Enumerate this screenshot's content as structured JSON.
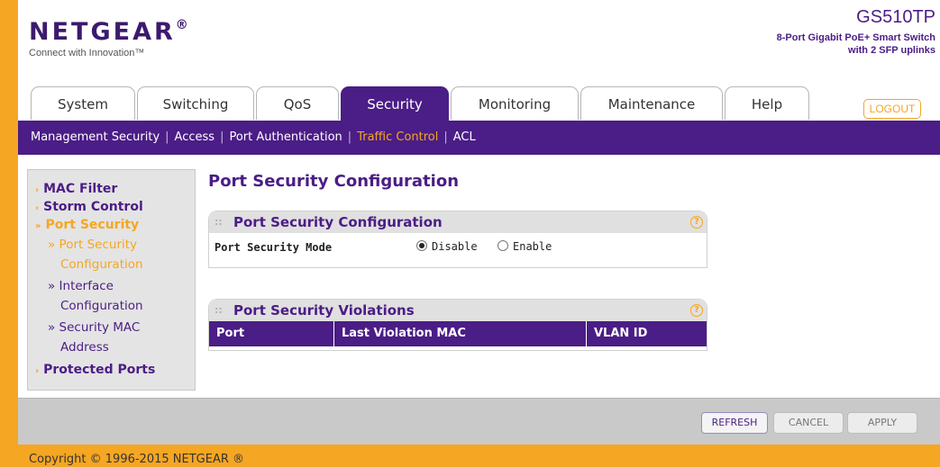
{
  "header": {
    "brand": "NETGEAR",
    "brand_mark": "®",
    "tagline": "Connect with Innovation™",
    "model": "GS510TP",
    "model_desc_line1": "8-Port Gigabit PoE+ Smart Switch",
    "model_desc_line2": "with 2 SFP uplinks",
    "logout_label": "LOGOUT"
  },
  "tabs": [
    {
      "label": "System"
    },
    {
      "label": "Switching"
    },
    {
      "label": "QoS"
    },
    {
      "label": "Security"
    },
    {
      "label": "Monitoring"
    },
    {
      "label": "Maintenance"
    },
    {
      "label": "Help"
    }
  ],
  "subnav": {
    "items": [
      {
        "label": "Management Security"
      },
      {
        "label": "Access"
      },
      {
        "label": "Port Authentication"
      },
      {
        "label": "Traffic Control"
      },
      {
        "label": "ACL"
      }
    ],
    "separator": "|"
  },
  "sidebar": {
    "items": [
      {
        "label": "MAC Filter"
      },
      {
        "label": "Storm Control"
      },
      {
        "label": "Port Security"
      },
      {
        "label": "» Port Security"
      },
      {
        "label": "Configuration"
      },
      {
        "label": "» Interface"
      },
      {
        "label": "Configuration"
      },
      {
        "label": "» Security MAC"
      },
      {
        "label": "Address"
      },
      {
        "label": "Protected Ports"
      }
    ],
    "arrow_closed": "›",
    "arrow_open": "»"
  },
  "main": {
    "page_title": "Port Security Configuration",
    "panel1": {
      "title": "Port Security Configuration",
      "mode_label": "Port Security Mode",
      "option_disable": "Disable",
      "option_enable": "Enable",
      "selected": "Disable"
    },
    "panel2": {
      "title": "Port Security Violations",
      "columns": [
        "Port",
        "Last Violation MAC",
        "VLAN ID"
      ]
    },
    "grip": "::",
    "help": "?"
  },
  "buttons": {
    "refresh": "REFRESH",
    "cancel": "CANCEL",
    "apply": "APPLY"
  },
  "footer": {
    "copyright": "Copyright © 1996-2015 NETGEAR ®"
  },
  "colors": {
    "purple": "#4b1d86",
    "orange": "#f5a623"
  }
}
